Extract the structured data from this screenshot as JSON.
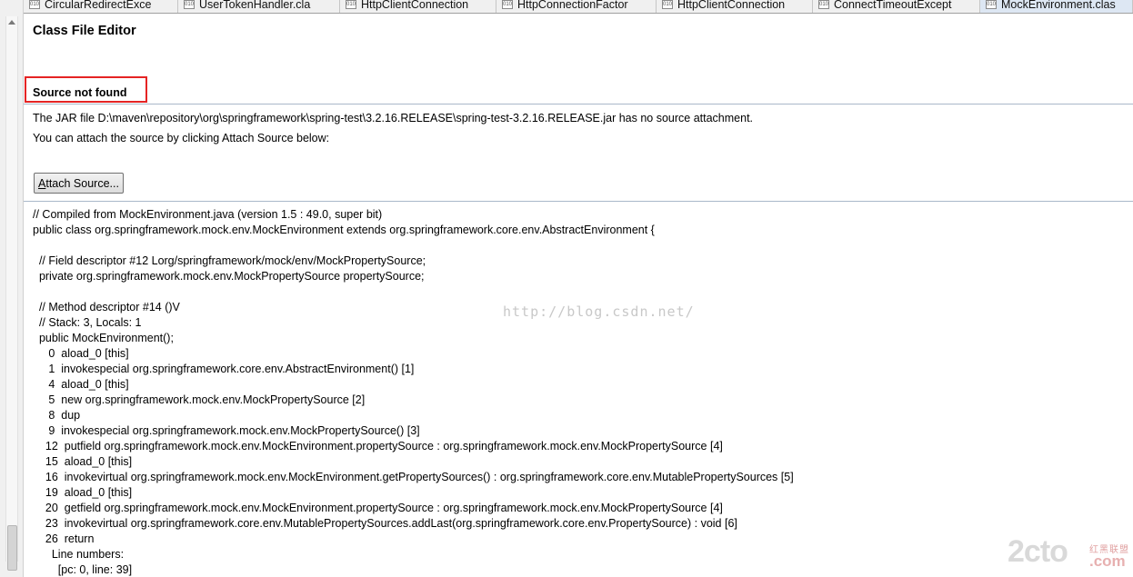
{
  "tabs": [
    {
      "label": "CircularRedirectExce",
      "active": false
    },
    {
      "label": "UserTokenHandler.cla",
      "active": false
    },
    {
      "label": "HttpClientConnection",
      "active": false
    },
    {
      "label": "HttpConnectionFactor",
      "active": false
    },
    {
      "label": "HttpClientConnection",
      "active": false
    },
    {
      "label": "ConnectTimeoutExcept",
      "active": false
    },
    {
      "label": "MockEnvironment.clas",
      "active": true
    }
  ],
  "tab_icon_text": "010",
  "editor": {
    "title": "Class File Editor",
    "source_not_found": "Source not found",
    "jar_message": "The JAR file D:\\maven\\repository\\org\\springframework\\spring-test\\3.2.16.RELEASE\\spring-test-3.2.16.RELEASE.jar has no source attachment.",
    "attach_hint": "You can attach the source by clicking Attach Source below:",
    "attach_button_mnemonic": "A",
    "attach_button_rest": "ttach Source..."
  },
  "code_lines": [
    "// Compiled from MockEnvironment.java (version 1.5 : 49.0, super bit)",
    "public class org.springframework.mock.env.MockEnvironment extends org.springframework.core.env.AbstractEnvironment {",
    "",
    "  // Field descriptor #12 Lorg/springframework/mock/env/MockPropertySource;",
    "  private org.springframework.mock.env.MockPropertySource propertySource;",
    "",
    "  // Method descriptor #14 ()V",
    "  // Stack: 3, Locals: 1",
    "  public MockEnvironment();",
    "     0  aload_0 [this]",
    "     1  invokespecial org.springframework.core.env.AbstractEnvironment() [1]",
    "     4  aload_0 [this]",
    "     5  new org.springframework.mock.env.MockPropertySource [2]",
    "     8  dup",
    "     9  invokespecial org.springframework.mock.env.MockPropertySource() [3]",
    "    12  putfield org.springframework.mock.env.MockEnvironment.propertySource : org.springframework.mock.env.MockPropertySource [4]",
    "    15  aload_0 [this]",
    "    16  invokevirtual org.springframework.mock.env.MockEnvironment.getPropertySources() : org.springframework.core.env.MutablePropertySources [5]",
    "    19  aload_0 [this]",
    "    20  getfield org.springframework.mock.env.MockEnvironment.propertySource : org.springframework.mock.env.MockPropertySource [4]",
    "    23  invokevirtual org.springframework.core.env.MutablePropertySources.addLast(org.springframework.core.env.PropertySource) : void [6]",
    "    26  return",
    "      Line numbers:",
    "        [pc: 0, line: 39]"
  ],
  "watermark": "http://blog.csdn.net/",
  "logo": {
    "main": "2cto",
    "cn": "红黑联盟",
    "dotcom": ".com"
  }
}
